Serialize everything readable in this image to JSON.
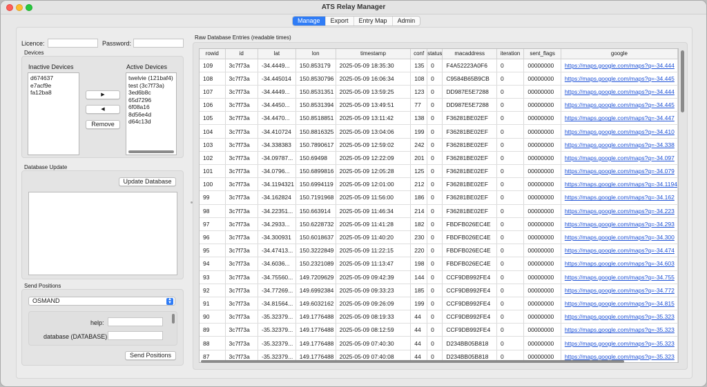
{
  "window": {
    "title": "ATS Relay Manager"
  },
  "tabs": [
    {
      "label": "Manage",
      "active": true
    },
    {
      "label": "Export",
      "active": false
    },
    {
      "label": "Entry Map",
      "active": false
    },
    {
      "label": "Admin",
      "active": false
    }
  ],
  "auth": {
    "licence_label": "Licence:",
    "licence_value": "",
    "password_label": "Password:",
    "password_value": ""
  },
  "devices": {
    "group_title": "Devices",
    "inactive_label": "Inactive Devices",
    "inactive_items": [
      "d674637",
      "e7acf9e",
      "fa12ba8"
    ],
    "active_label": "Active Devices",
    "active_items": [
      "twelvie  (121baf4)",
      "test  (3c7f73a)",
      "3ed6b8c",
      "65d7296",
      "6f08a16",
      "8d56e4d",
      "d64c13d"
    ],
    "move_right": "▶",
    "move_left": "◀",
    "remove_label": "Remove"
  },
  "db_update": {
    "group_title": "Database Update",
    "button_label": "Update Database",
    "log_text": ""
  },
  "send_positions": {
    "group_title": "Send Positions",
    "mode": "OSMAND",
    "help_label": "help:",
    "help_value": "",
    "database_label": "database (DATABASE):",
    "database_value": "",
    "button_label": "Send Positions"
  },
  "raw_db": {
    "title": "Raw Database Entries (readable times)",
    "columns": [
      "rowid",
      "id",
      "lat",
      "lon",
      "timestamp",
      "conf",
      "status",
      "macaddress",
      "iteration",
      "sent_flags",
      "google"
    ],
    "rows": [
      [
        "109",
        "3c7f73a",
        "-34.4449...",
        "150.853179",
        "2025-05-09 18:35:30",
        "135",
        "0",
        "F4A52223A0F6",
        "0",
        "00000000",
        "https://maps.google.com/maps?q=-34.444"
      ],
      [
        "108",
        "3c7f73a",
        "-34.445014",
        "150.8530796",
        "2025-05-09 16:06:34",
        "108",
        "0",
        "C9584B65B9CB",
        "0",
        "00000000",
        "https://maps.google.com/maps?q=-34.445"
      ],
      [
        "107",
        "3c7f73a",
        "-34.4449...",
        "150.8531351",
        "2025-05-09 13:59:25",
        "123",
        "0",
        "DD987E5E7288",
        "0",
        "00000000",
        "https://maps.google.com/maps?q=-34.444"
      ],
      [
        "106",
        "3c7f73a",
        "-34.4450...",
        "150.8531394",
        "2025-05-09 13:49:51",
        "77",
        "0",
        "DD987E5E7288",
        "0",
        "00000000",
        "https://maps.google.com/maps?q=-34.445"
      ],
      [
        "105",
        "3c7f73a",
        "-34.4470...",
        "150.8518851",
        "2025-05-09 13:11:42",
        "138",
        "0",
        "F36281BE02EF",
        "0",
        "00000000",
        "https://maps.google.com/maps?q=-34.447"
      ],
      [
        "104",
        "3c7f73a",
        "-34.410724",
        "150.8816325",
        "2025-05-09 13:04:06",
        "199",
        "0",
        "F36281BE02EF",
        "0",
        "00000000",
        "https://maps.google.com/maps?q=-34.410"
      ],
      [
        "103",
        "3c7f73a",
        "-34.338383",
        "150.7890617",
        "2025-05-09 12:59:02",
        "242",
        "0",
        "F36281BE02EF",
        "0",
        "00000000",
        "https://maps.google.com/maps?q=-34.338"
      ],
      [
        "102",
        "3c7f73a",
        "-34.09787...",
        "150.69498",
        "2025-05-09 12:22:09",
        "201",
        "0",
        "F36281BE02EF",
        "0",
        "00000000",
        "https://maps.google.com/maps?q=-34.097"
      ],
      [
        "101",
        "3c7f73a",
        "-34.0796...",
        "150.6899816",
        "2025-05-09 12:05:28",
        "125",
        "0",
        "F36281BE02EF",
        "0",
        "00000000",
        "https://maps.google.com/maps?q=-34.079"
      ],
      [
        "100",
        "3c7f73a",
        "-34.1194321",
        "150.6994119",
        "2025-05-09 12:01:00",
        "212",
        "0",
        "F36281BE02EF",
        "0",
        "00000000",
        "https://maps.google.com/maps?q=-34.1194"
      ],
      [
        "99",
        "3c7f73a",
        "-34.162824",
        "150.7191968",
        "2025-05-09 11:56:00",
        "186",
        "0",
        "F36281BE02EF",
        "0",
        "00000000",
        "https://maps.google.com/maps?q=-34.162"
      ],
      [
        "98",
        "3c7f73a",
        "-34.22351...",
        "150.663914",
        "2025-05-09 11:46:34",
        "214",
        "0",
        "F36281BE02EF",
        "0",
        "00000000",
        "https://maps.google.com/maps?q=-34.223"
      ],
      [
        "97",
        "3c7f73a",
        "-34.2933...",
        "150.6228732",
        "2025-05-09 11:41:28",
        "182",
        "0",
        "FBDFB026EC4E",
        "0",
        "00000000",
        "https://maps.google.com/maps?q=-34.293"
      ],
      [
        "96",
        "3c7f73a",
        "-34.300931",
        "150.6018637",
        "2025-05-09 11:40:20",
        "230",
        "0",
        "FBDFB026EC4E",
        "0",
        "00000000",
        "https://maps.google.com/maps?q=-34.300"
      ],
      [
        "95",
        "3c7f73a",
        "-34.47413...",
        "150.3222849",
        "2025-05-09 11:22:15",
        "220",
        "0",
        "FBDFB026EC4E",
        "0",
        "00000000",
        "https://maps.google.com/maps?q=-34.474"
      ],
      [
        "94",
        "3c7f73a",
        "-34.6036...",
        "150.2321089",
        "2025-05-09 11:13:47",
        "198",
        "0",
        "FBDFB026EC4E",
        "0",
        "00000000",
        "https://maps.google.com/maps?q=-34.603"
      ],
      [
        "93",
        "3c7f73a",
        "-34.75560...",
        "149.7209629",
        "2025-05-09 09:42:39",
        "144",
        "0",
        "CCF9DB992FE4",
        "0",
        "00000000",
        "https://maps.google.com/maps?q=-34.755"
      ],
      [
        "92",
        "3c7f73a",
        "-34.77269...",
        "149.6992384",
        "2025-05-09 09:33:23",
        "185",
        "0",
        "CCF9DB992FE4",
        "0",
        "00000000",
        "https://maps.google.com/maps?q=-34.772"
      ],
      [
        "91",
        "3c7f73a",
        "-34.81564...",
        "149.6032162",
        "2025-05-09 09:26:09",
        "199",
        "0",
        "CCF9DB992FE4",
        "0",
        "00000000",
        "https://maps.google.com/maps?q=-34.815"
      ],
      [
        "90",
        "3c7f73a",
        "-35.32379...",
        "149.1776488",
        "2025-05-09 08:19:33",
        "44",
        "0",
        "CCF9DB992FE4",
        "0",
        "00000000",
        "https://maps.google.com/maps?q=-35.323"
      ],
      [
        "89",
        "3c7f73a",
        "-35.32379...",
        "149.1776488",
        "2025-05-09 08:12:59",
        "44",
        "0",
        "CCF9DB992FE4",
        "0",
        "00000000",
        "https://maps.google.com/maps?q=-35.323"
      ],
      [
        "88",
        "3c7f73a",
        "-35.32379...",
        "149.1776488",
        "2025-05-09 07:40:30",
        "44",
        "0",
        "D234BB05B818",
        "0",
        "00000000",
        "https://maps.google.com/maps?q=-35.323"
      ],
      [
        "87",
        "3c7f73a",
        "-35.32379...",
        "149.1776488",
        "2025-05-09 07:40:08",
        "44",
        "0",
        "D234BB05B818",
        "0",
        "00000000",
        "https://maps.google.com/maps?q=-35.323"
      ]
    ]
  },
  "colors": {
    "accent": "#2f7cf6",
    "link": "#1a4fd6"
  }
}
